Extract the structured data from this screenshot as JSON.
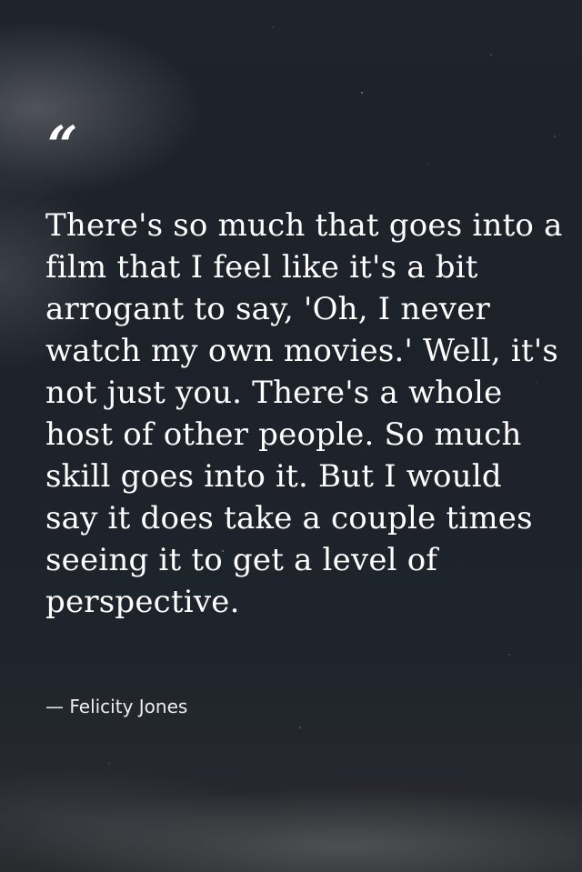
{
  "quote": {
    "mark": "“",
    "text": "There's so much that goes into a film that I feel like it's a bit arrogant to say, 'Oh, I never watch my own movies.' Well, it's not just you. There's a whole host of other people. So much skill goes into it. But I would say it does take a couple times seeing it to get a level of perspective.",
    "author": "— Felicity Jones"
  },
  "colors": {
    "background": "#1f232b",
    "text": "#ffffff"
  }
}
